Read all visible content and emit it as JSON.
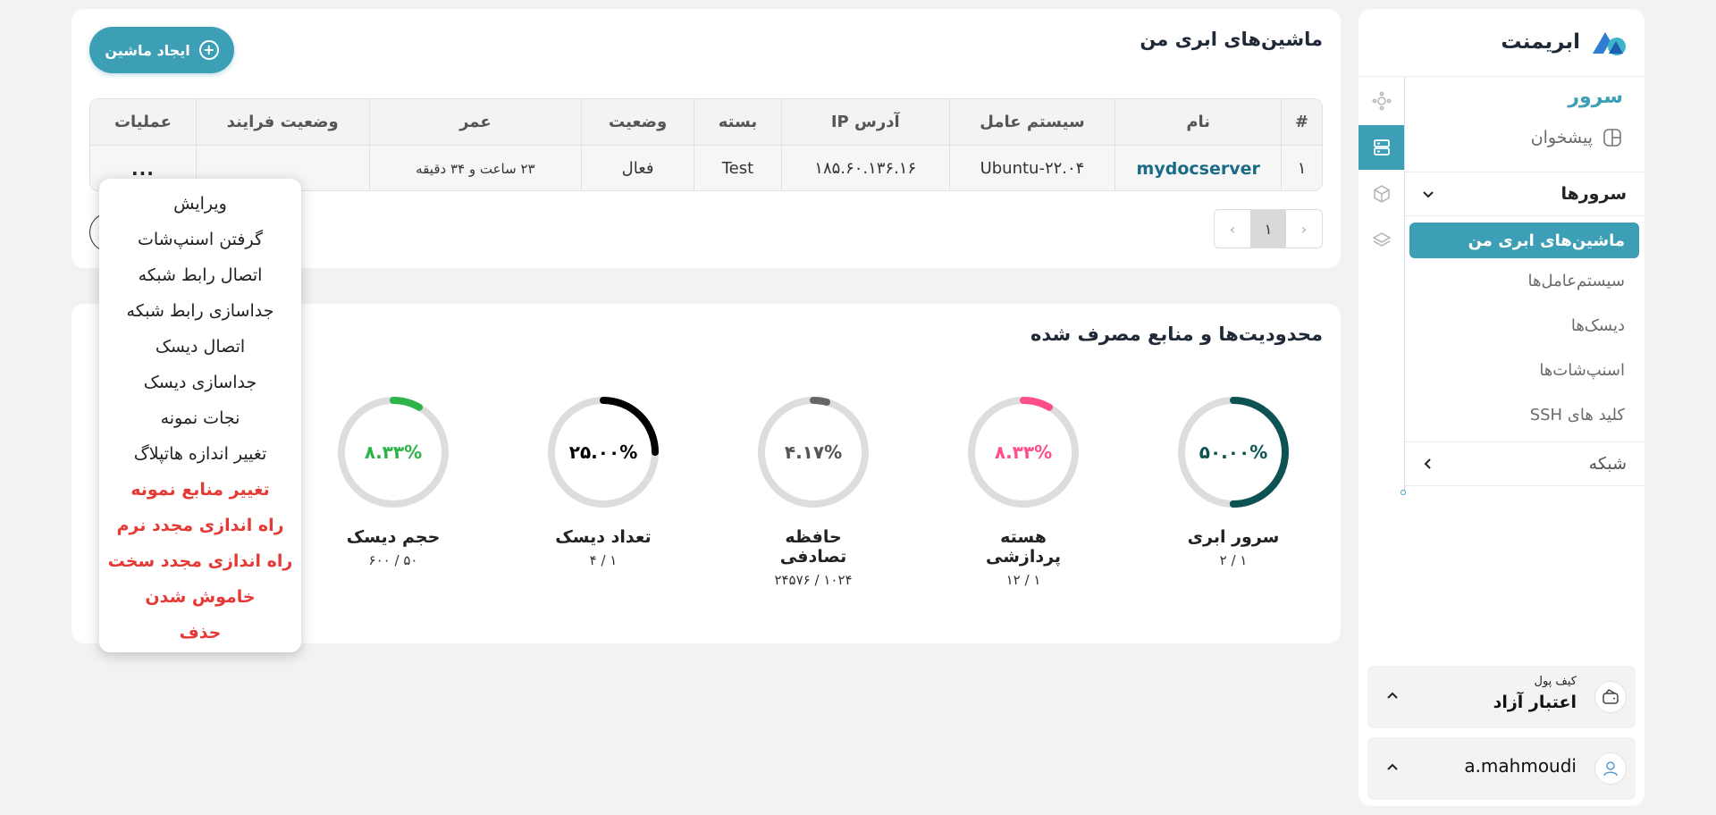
{
  "brand": {
    "name": "ابریمنت"
  },
  "sidebar": {
    "section_title": "سرور",
    "dashboard_label": "پیشخوان",
    "servers_group": "سرورها",
    "items": [
      {
        "label": "ماشین‌های ابری من",
        "active": true
      },
      {
        "label": "سیستم‌عامل‌ها",
        "active": false
      },
      {
        "label": "دیسک‌ها",
        "active": false
      },
      {
        "label": "اسنپ‌شات‌ها",
        "active": false
      },
      {
        "label": "کلید های SSH",
        "active": false
      }
    ],
    "network_group": "شبکه",
    "wallet": {
      "small": "کیف پول",
      "big": "اعتبار آزاد"
    },
    "user": {
      "name": "a.mahmoudi"
    }
  },
  "machines": {
    "title": "ماشین‌های ابری من",
    "create_button": "ایجاد ماشین",
    "columns": [
      "#",
      "نام",
      "سیستم عامل",
      "آدرس IP",
      "بسته",
      "وضعیت",
      "عمر",
      "وضعیت فرایند",
      "عملیات"
    ],
    "rows": [
      {
        "index": "۱",
        "name": "mydocserver",
        "os": "Ubuntu-۲۲.۰۴",
        "ip": "۱۸۵.۶۰.۱۳۶.۱۶",
        "package": "Test",
        "status": "فعال",
        "age": "۲۳ ساعت و ۳۴ دقیقه",
        "process": "",
        "actions": "..."
      }
    ],
    "pagination": {
      "current": "۱",
      "prev": "‹",
      "next": "›"
    }
  },
  "limits": {
    "title": "محدودیت‌ها و منابع مصرف شده",
    "gauges": [
      {
        "label": "سرور ابری",
        "percent": 50,
        "percent_text": "۵۰.۰۰%",
        "usage": "۱ / ۲",
        "color": "#0d5353"
      },
      {
        "label": "هسته پردازشی",
        "percent": 8.33,
        "percent_text": "۸.۳۳%",
        "usage": "۱ / ۱۲",
        "color": "#ff4f8b"
      },
      {
        "label": "حافظه تصادفی",
        "percent": 4.17,
        "percent_text": "۴.۱۷%",
        "usage": "۱۰۲۴ / ۲۴۵۷۶",
        "color": "#666666"
      },
      {
        "label": "تعداد دیسک",
        "percent": 25,
        "percent_text": "۲۵.۰۰%",
        "usage": "۱ / ۴",
        "color": "#000000"
      },
      {
        "label": "حجم دیسک",
        "percent": 8.33,
        "percent_text": "۸.۳۳%",
        "usage": "۵۰ / ۶۰۰",
        "color": "#2db34a"
      }
    ]
  },
  "menu": {
    "items": [
      {
        "label": "ویرایش",
        "danger": false
      },
      {
        "label": "گرفتن اسنپ‌شات",
        "danger": false
      },
      {
        "label": "اتصال رابط شبکه",
        "danger": false
      },
      {
        "label": "جداسازی رابط شبکه",
        "danger": false
      },
      {
        "label": "اتصال دیسک",
        "danger": false
      },
      {
        "label": "جداسازی دیسک",
        "danger": false
      },
      {
        "label": "نجات نمونه",
        "danger": false
      },
      {
        "label": "تغییر اندازه هاتپلاگ",
        "danger": false
      },
      {
        "label": "تغییر منابع نمونه",
        "danger": true
      },
      {
        "label": "راه اندازی مجدد نرم",
        "danger": true
      },
      {
        "label": "راه اندازی مجدد سخت",
        "danger": true
      },
      {
        "label": "خاموش شدن",
        "danger": true
      },
      {
        "label": "حذف",
        "danger": true
      }
    ]
  },
  "colors": {
    "accent": "#3d9fb6",
    "danger": "#e53935",
    "track": "#dddddd"
  }
}
